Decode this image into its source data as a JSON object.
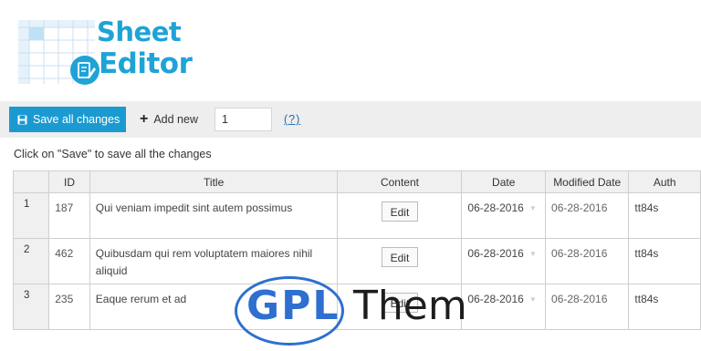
{
  "logo": {
    "line1": "Sheet",
    "line2": "Editor"
  },
  "toolbar": {
    "save_label": "Save all changes",
    "add_new_label": "Add new",
    "quantity_value": "1",
    "help_label": "(?)"
  },
  "hint": "Click on \"Save\" to save all the changes",
  "table": {
    "columns": [
      "",
      "ID",
      "Title",
      "Content",
      "Date",
      "Modified Date",
      "Auth"
    ],
    "rows": [
      {
        "num": "1",
        "id": "187",
        "title": "Qui veniam impedit sint autem possimus",
        "content": "Edit",
        "date": "06-28-2016",
        "modified": "06-28-2016",
        "author": "tt84s"
      },
      {
        "num": "2",
        "id": "462",
        "title": "Quibusdam qui rem voluptatem maiores nihil aliquid",
        "content": "Edit",
        "date": "06-28-2016",
        "modified": "06-28-2016",
        "author": "tt84s"
      },
      {
        "num": "3",
        "id": "235",
        "title": "Eaque rerum et ad",
        "content": "Edit",
        "date": "06-28-2016",
        "modified": "06-28-2016",
        "author": "tt84s"
      }
    ]
  },
  "watermark": {
    "left": "GPL",
    "right": "Them"
  },
  "colors": {
    "accent": "#1a9ad1",
    "logo": "#1fa3d6",
    "watermark_blue": "#2e6fd0"
  },
  "icons": {
    "save": "floppy-disk-icon",
    "add": "plus-icon",
    "date": "caret-down-icon"
  }
}
